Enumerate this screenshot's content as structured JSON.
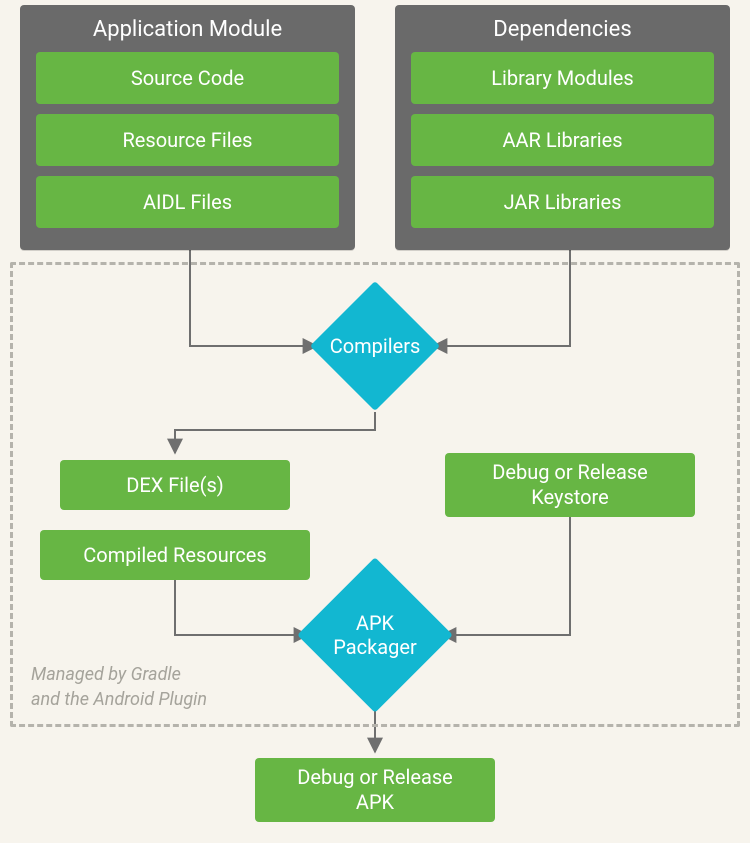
{
  "application_module": {
    "title": "Application Module",
    "items": [
      "Source Code",
      "Resource Files",
      "AIDL Files"
    ]
  },
  "dependencies": {
    "title": "Dependencies",
    "items": [
      "Library Modules",
      "AAR Libraries",
      "JAR Libraries"
    ]
  },
  "compilers_label": "Compilers",
  "dex_label": "DEX File(s)",
  "compiled_resources_label": "Compiled Resources",
  "keystore_label": "Debug or Release\nKeystore",
  "apk_packager_label": "APK\nPackager",
  "apk_output_label": "Debug or Release\nAPK",
  "gradle_caption_line1": "Managed by Gradle",
  "gradle_caption_line2": "and the Android Plugin",
  "colors": {
    "module_bg": "#6a6a6a",
    "green": "#67b644",
    "diamond": "#12b7d1",
    "dash": "#b5b3ac",
    "page_bg": "#f7f4ed"
  }
}
